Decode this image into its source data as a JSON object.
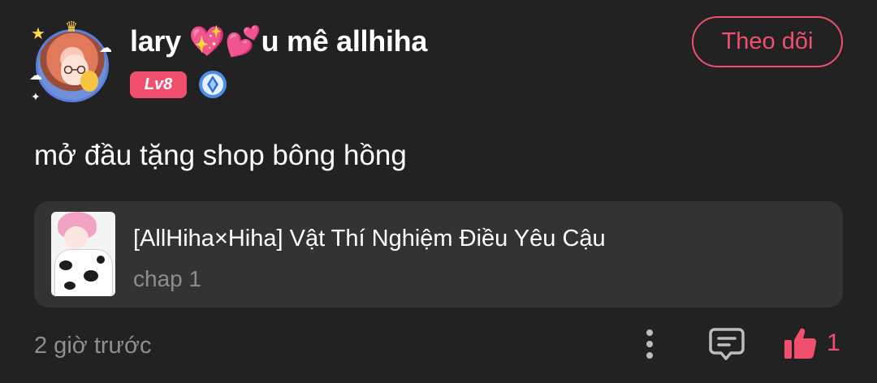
{
  "author": {
    "name": "lary 💖💕u mê allhiha",
    "level": "Lv8",
    "avatar_icon": "anime-avatar",
    "rank_icon": "diamond-rank-icon"
  },
  "follow_button": {
    "label": "Theo dõi"
  },
  "post": {
    "text": "mở đầu tặng shop bông hồng"
  },
  "linked_comic": {
    "title": "[AllHiha×Hiha] Vật Thí Nghiệm Điều Yêu Cậu",
    "chapter": "chap 1"
  },
  "footer": {
    "time": "2 giờ trước",
    "like_count": "1",
    "icons": [
      "more-vertical-icon",
      "comment-icon",
      "thumbs-up-icon"
    ]
  },
  "colors": {
    "background": "#222222",
    "card": "#333333",
    "accent": "#f0506e",
    "muted_text": "#8f8f8f"
  }
}
